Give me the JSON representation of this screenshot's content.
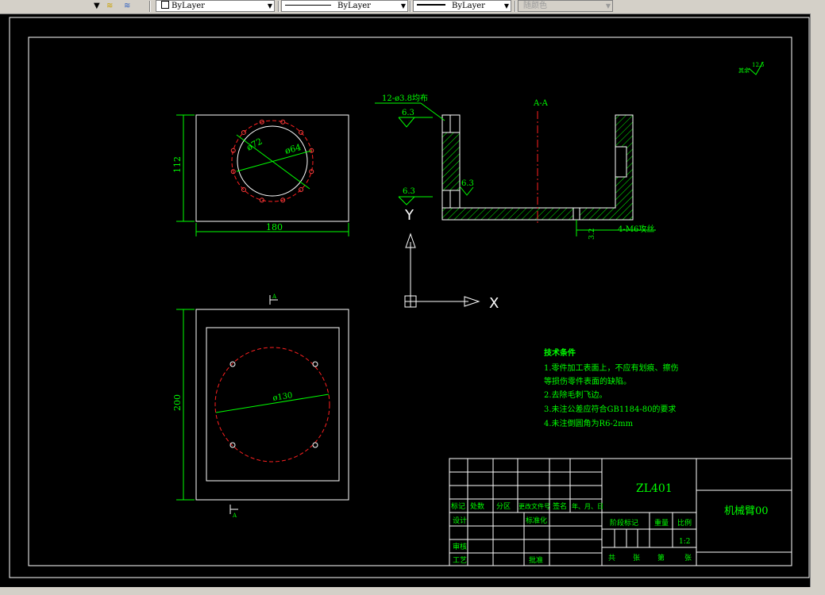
{
  "toolbar": {
    "layer_combo": "ByLayer",
    "linetype_combo": "ByLayer",
    "lineweight_combo": "ByLayer",
    "color_combo": "随颜色"
  },
  "drawing": {
    "section_label": "A-A",
    "top_view": {
      "height_dim": "112",
      "width_dim": "180",
      "dia_outer": "ø72",
      "dia_inner": "ø64"
    },
    "section_view": {
      "hole_note": "12-ø3.8均布",
      "roughness_top": "6.3",
      "roughness_bottom": "6.3",
      "roughness_inner": "6.3",
      "bottom_hole_note": "4-M6攻丝",
      "bottom_depth": "3.2"
    },
    "bottom_view": {
      "height_dim": "200",
      "dia": "ø130",
      "section_mark_top": "A",
      "section_mark_bottom": "A"
    },
    "ucs": {
      "x_axis": "X",
      "y_axis": "Y"
    },
    "roughness_corner": "12.5",
    "roughness_corner_label": "其余",
    "tech_requirements": {
      "title": "技术条件",
      "lines": [
        "1.零件加工表面上，不应有划痕、擦伤",
        "等损伤零件表面的缺陷。",
        "2.去除毛刺飞边。",
        "3.未注公差应符合GB1184-80的要求",
        "4.未注倒圆角为R6-2mm"
      ]
    },
    "title_block": {
      "material": "ZL401",
      "part_name": "机械臂00",
      "headers": [
        "标记",
        "处数",
        "分区",
        "更改文件号",
        "签名",
        "年、月、日"
      ],
      "row_design": "设计",
      "row_standard": "标准化",
      "row_review": "审核",
      "row_process": "工艺",
      "row_approve": "批准",
      "stage_label": "阶段标记",
      "weight_label": "重量",
      "scale_label": "比例",
      "scale_value": "1:2",
      "sheets_total": "共",
      "sheets_unit": "张",
      "sheet_no": "第",
      "sheet_unit2": "张"
    }
  }
}
